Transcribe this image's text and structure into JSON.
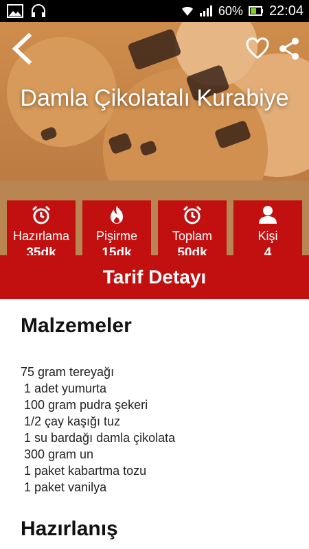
{
  "status_bar": {
    "battery": "60%",
    "time": "22:04"
  },
  "recipe": {
    "title": "Damla Çikolatalı Kurabiye"
  },
  "stats": [
    {
      "label": "Hazırlama",
      "value": "35dk",
      "icon": "alarm-clock-icon"
    },
    {
      "label": "Pişirme",
      "value": "15dk",
      "icon": "flame-icon"
    },
    {
      "label": "Toplam",
      "value": "50dk",
      "icon": "alarm-clock-icon"
    },
    {
      "label": "Kişi",
      "value": "4",
      "icon": "person-icon"
    }
  ],
  "detail_bar": {
    "label": "Tarif Detayı"
  },
  "sections": {
    "ingredients_title": "Malzemeler",
    "preparation_title": "Hazırlanış"
  },
  "ingredients": [
    "75 gram tereyağı",
    " 1 adet yumurta",
    " 100 gram pudra şekeri",
    " 1/2 çay kaşığı tuz",
    " 1 su bardağı damla çikolata",
    " 300 gram un",
    " 1 paket kabartma tozu",
    " 1 paket vanilya"
  ],
  "colors": {
    "primary_red": "#c20f0f",
    "band_brown": "#b98552"
  }
}
